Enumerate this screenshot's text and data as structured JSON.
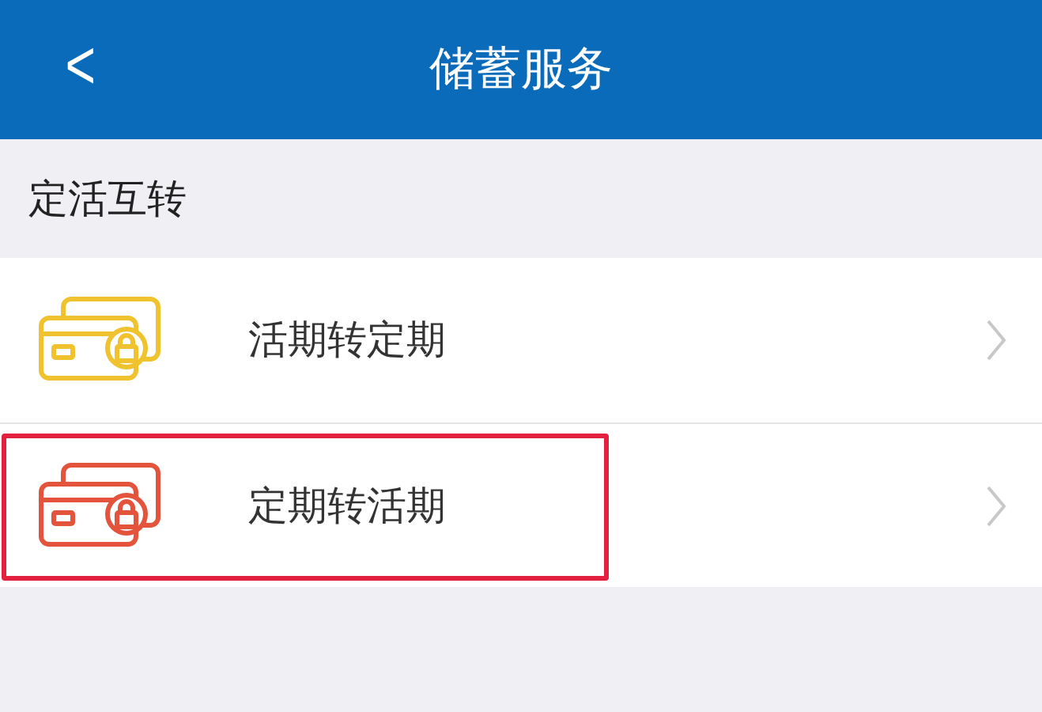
{
  "header": {
    "back": "<",
    "title": "储蓄服务"
  },
  "section": {
    "title": "定活互转"
  },
  "items": [
    {
      "label": "活期转定期",
      "color": "#f0c22e",
      "highlighted": false
    },
    {
      "label": "定期转活期",
      "color": "#e4533c",
      "highlighted": true
    }
  ]
}
